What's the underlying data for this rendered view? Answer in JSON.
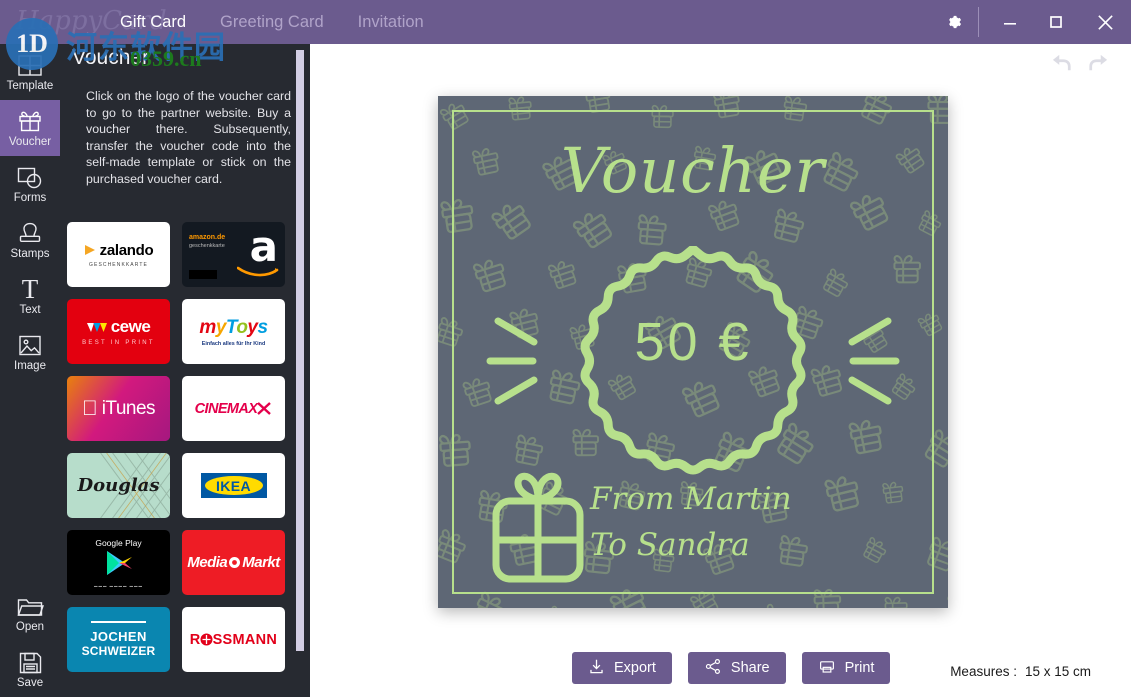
{
  "window": {
    "brand": "HappyCard",
    "tabs": [
      {
        "label": "Gift Card",
        "active": true
      },
      {
        "label": "Greeting Card",
        "active": false
      },
      {
        "label": "Invitation",
        "active": false
      }
    ],
    "controls": {
      "settings": "gear-icon",
      "minimize": "minimize-icon",
      "maximize": "maximize-icon",
      "close": "close-icon"
    }
  },
  "watermark": {
    "badge": "1D",
    "site": "河东软件园",
    "domain": "0359.cn"
  },
  "rail": {
    "items": [
      {
        "label": "Template",
        "icon": "template-grid-icon",
        "active": false
      },
      {
        "label": "Voucher",
        "icon": "gift-icon",
        "active": true
      },
      {
        "label": "Forms",
        "icon": "shapes-icon",
        "active": false
      },
      {
        "label": "Stamps",
        "icon": "stamp-icon",
        "active": false
      },
      {
        "label": "Text",
        "icon": "text-t-icon",
        "active": false
      },
      {
        "label": "Image",
        "icon": "image-icon",
        "active": false
      }
    ],
    "bottom": [
      {
        "label": "Open",
        "icon": "folder-icon"
      },
      {
        "label": "Save",
        "icon": "floppy-disk-icon"
      }
    ]
  },
  "panel": {
    "title": "Voucher",
    "description": "Click on the logo of the voucher card to go to the partner website. Buy a voucher there. Subsequently, transfer the voucher code into the self-made template or stick on the purchased voucher card.",
    "collapse_icon": "chevron-left-icon",
    "vouchers": [
      {
        "name": "zalando",
        "subtitle": "GESCHENKKARTE",
        "bg": "#ffffff",
        "fg": "#000000",
        "accent": "#f5a623",
        "style": "zalando"
      },
      {
        "name": "amazon.de",
        "subtitle": "geschenkkarte",
        "bg": "#131921",
        "fg": "#ffffff",
        "accent": "#ff9900",
        "style": "amazon"
      },
      {
        "name": "cewe",
        "subtitle": "BEST IN PRINT",
        "bg": "#e3000f",
        "fg": "#ffffff",
        "accent": "#ffffff",
        "style": "cewe"
      },
      {
        "name": "myToys",
        "subtitle": "Einfach alles für Ihr Kind",
        "bg": "#ffffff",
        "fg": "#1b3a80",
        "accent": "#f7a600",
        "style": "mytoys"
      },
      {
        "name": "iTunes",
        "subtitle": "",
        "bg": "#c2187f",
        "fg": "#ffffff",
        "accent": "#e8820c",
        "style": "itunes"
      },
      {
        "name": "CINEMAXX",
        "subtitle": "",
        "bg": "#ffffff",
        "fg": "#e4004b",
        "accent": "#e4004b",
        "style": "cinemaxx"
      },
      {
        "name": "Douglas",
        "subtitle": "",
        "bg": "#b7ddcb",
        "fg": "#1a1a1a",
        "accent": "#8aa79a",
        "style": "douglas"
      },
      {
        "name": "IKEA",
        "subtitle": "",
        "bg": "#ffffff",
        "fg": "#0058a3",
        "accent": "#ffdb00",
        "style": "ikea"
      },
      {
        "name": "Google Play",
        "subtitle": "",
        "bg": "#000000",
        "fg": "#ffffff",
        "accent": "#00d0c0",
        "style": "googleplay"
      },
      {
        "name": "Media Markt",
        "subtitle": "",
        "bg": "#ee1c25",
        "fg": "#ffffff",
        "accent": "#ffffff",
        "style": "mediamarkt"
      },
      {
        "name": "JOCHEN",
        "subtitle": "SCHWEIZER",
        "bg": "#0a86b0",
        "fg": "#ffffff",
        "accent": "#ffffff",
        "style": "jochen"
      },
      {
        "name": "ROSSMANN",
        "subtitle": "",
        "bg": "#ffffff",
        "fg": "#e2001a",
        "accent": "#e2001a",
        "style": "rossmann"
      }
    ]
  },
  "history": {
    "undo": "undo-icon",
    "redo": "redo-icon"
  },
  "card": {
    "title": "Voucher",
    "amount": "50 €",
    "from_line": "From Martin",
    "to_line": "To Sandra",
    "bg_color": "#5e6775",
    "accent_color": "#b7e08c"
  },
  "toolbar": {
    "export_label": "Export",
    "share_label": "Share",
    "print_label": "Print",
    "export_icon": "download-icon",
    "share_icon": "share-icon",
    "print_icon": "printer-icon"
  },
  "status": {
    "measures_label": "Measures :",
    "measures_value": "15 x 15 cm"
  }
}
